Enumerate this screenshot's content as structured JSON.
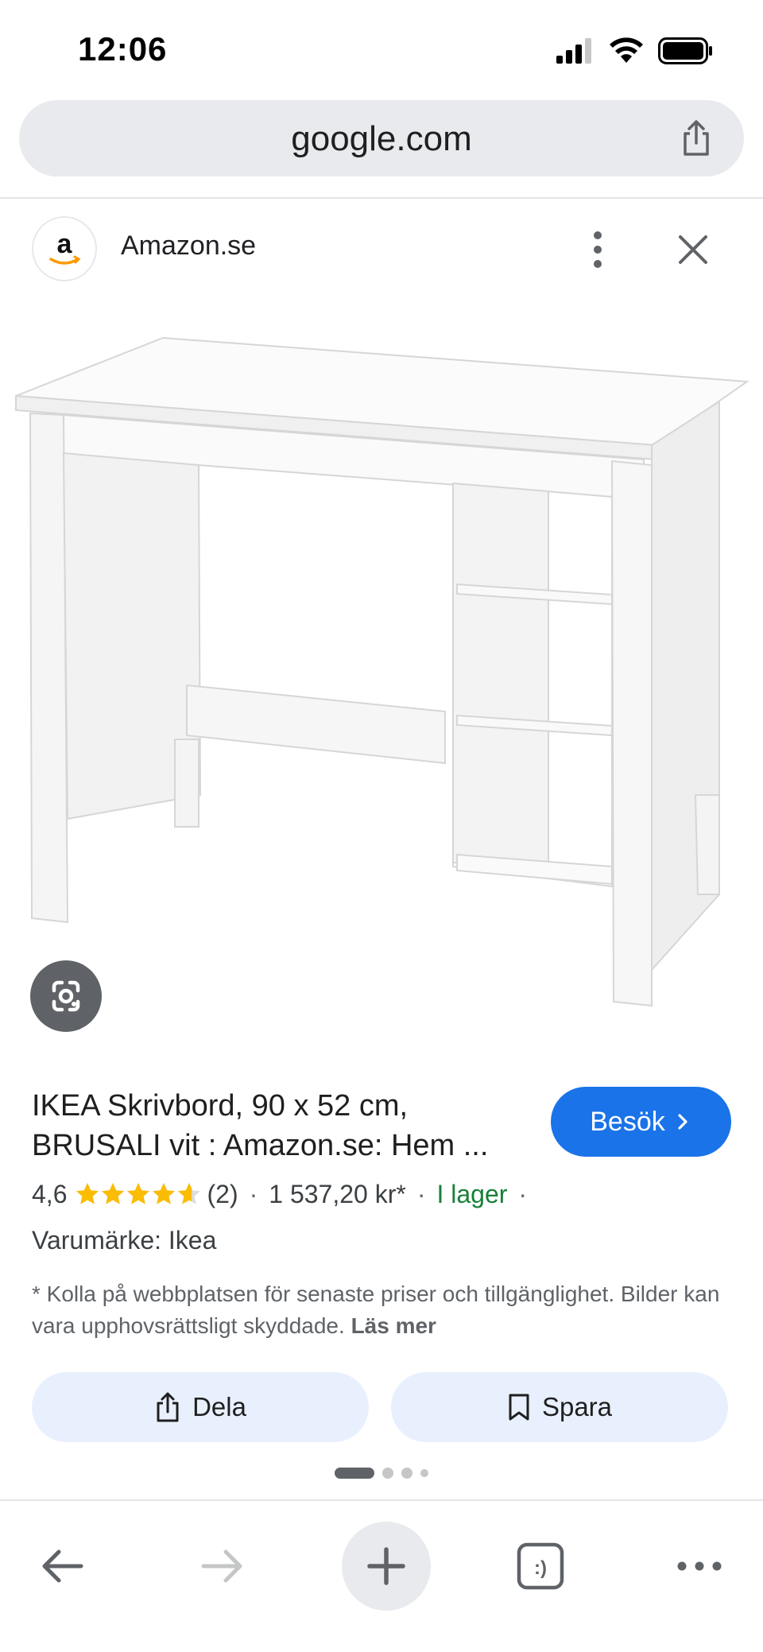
{
  "status_bar": {
    "time": "12:06"
  },
  "url_bar": {
    "url": "google.com"
  },
  "source": {
    "name": "Amazon.se",
    "logo_letter": "a"
  },
  "product": {
    "title": "IKEA Skrivbord, 90 x 52 cm, BRUSALI vit : Amazon.se: Hem ...",
    "rating": "4,6",
    "rating_stars": 4.6,
    "review_count": "(2)",
    "price": "1 537,20 kr*",
    "stock": "I lager",
    "brand": "Varumärke: Ikea",
    "disclaimer": "* Kolla på webbplatsen för senaste priser och tillgänglighet. Bilder kan vara upphovsrättsligt skyddade.",
    "read_more": "Läs mer"
  },
  "buttons": {
    "visit": "Besök",
    "share": "Dela",
    "save": "Spara"
  },
  "carousel": {
    "pages": 4,
    "active_index": 0
  },
  "colors": {
    "accent": "#1a73e8",
    "stock_green": "#188038",
    "star": "#fbbc04",
    "chip_bg": "#e8f0fe"
  },
  "icons": {
    "top_share": "share-icon",
    "more": "more-vert-icon",
    "close": "close-icon",
    "lens": "google-lens-icon",
    "back": "back-arrow-icon",
    "forward": "forward-arrow-icon",
    "new_tab": "plus-icon",
    "tabs": "tab-switcher-icon",
    "menu": "more-horiz-icon"
  }
}
